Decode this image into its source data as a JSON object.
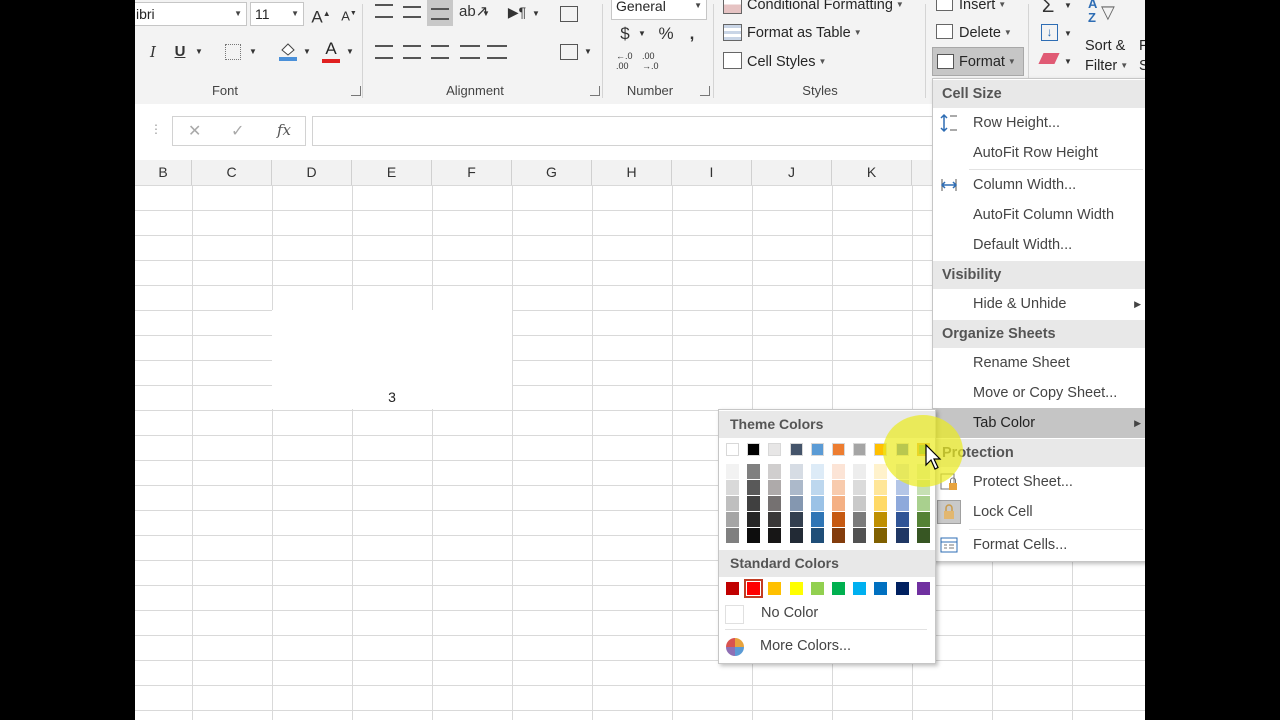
{
  "ribbon": {
    "font_name": "ibri",
    "font_size": "11",
    "number_format": "General",
    "currency": "$",
    "percent": "%",
    "comma": ",",
    "dec_inc": "←.0\n.00",
    "dec_dec": ".00\n→.0",
    "bold": "I",
    "underline": "U",
    "grow_font": "A",
    "shrink_font": "A",
    "font_color_letter": "A",
    "conditional_formatting": "Conditional Formatting",
    "format_as_table": "Format as Table",
    "cell_styles": "Cell Styles",
    "insert": "Insert",
    "delete": "Delete",
    "format": "Format",
    "sort_filter_line1": "Sort &",
    "sort_filter_line2": "Filter",
    "find_partial1": "F",
    "find_partial2": "S",
    "groups": {
      "font": "Font",
      "alignment": "Alignment",
      "number": "Number",
      "styles": "Styles"
    }
  },
  "formula_bar": {
    "cancel": "✕",
    "enter": "✓",
    "fx": "fx",
    "value": ""
  },
  "columns": [
    "B",
    "C",
    "D",
    "E",
    "F",
    "G",
    "H",
    "I",
    "J",
    "K"
  ],
  "cell_value": "3",
  "format_menu": {
    "cell_size_header": "Cell Size",
    "row_height": "Row Height...",
    "autofit_row_height": "AutoFit Row Height",
    "column_width": "Column Width...",
    "autofit_column_width": "AutoFit Column Width",
    "default_width": "Default Width...",
    "visibility_header": "Visibility",
    "hide_unhide": "Hide & Unhide",
    "organize_header": "Organize Sheets",
    "rename_sheet": "Rename Sheet",
    "move_copy": "Move or Copy Sheet...",
    "tab_color": "Tab Color",
    "protection_header": "Protection",
    "protect_sheet": "Protect Sheet...",
    "lock_cell": "Lock Cell",
    "format_cells": "Format Cells..."
  },
  "color_menu": {
    "theme_header": "Theme Colors",
    "standard_header": "Standard Colors",
    "no_color": "No Color",
    "more_colors": "More Colors...",
    "theme_top": [
      "#FFFFFF",
      "#000000",
      "#E7E6E6",
      "#44546A",
      "#5B9BD5",
      "#ED7D31",
      "#A5A5A5",
      "#FFC000",
      "#4472C4",
      "#70AD47"
    ],
    "theme_shades": [
      [
        "#F2F2F2",
        "#D9D9D9",
        "#BFBFBF",
        "#A6A6A6",
        "#808080"
      ],
      [
        "#808080",
        "#595959",
        "#404040",
        "#262626",
        "#0D0D0D"
      ],
      [
        "#D0CECE",
        "#AEAAAA",
        "#757171",
        "#3A3838",
        "#171616"
      ],
      [
        "#D6DCE4",
        "#ACB9CA",
        "#8497B0",
        "#333F4F",
        "#222A35"
      ],
      [
        "#DDEBF7",
        "#BDD7EE",
        "#9BC2E6",
        "#2F75B5",
        "#1F4E78"
      ],
      [
        "#FCE4D6",
        "#F8CBAD",
        "#F4B084",
        "#C65911",
        "#833C0C"
      ],
      [
        "#EDEDED",
        "#DBDBDB",
        "#C9C9C9",
        "#7B7B7B",
        "#525252"
      ],
      [
        "#FFF2CC",
        "#FFE699",
        "#FFD966",
        "#BF8F00",
        "#806000"
      ],
      [
        "#D9E1F2",
        "#B4C6E7",
        "#8EA9DB",
        "#305496",
        "#203764"
      ],
      [
        "#E2EFDA",
        "#C6E0B4",
        "#A9D08E",
        "#548235",
        "#375623"
      ]
    ],
    "standard": [
      "#C00000",
      "#FF0000",
      "#FFC000",
      "#FFFF00",
      "#92D050",
      "#00B050",
      "#00B0F0",
      "#0070C0",
      "#002060",
      "#7030A0"
    ]
  }
}
